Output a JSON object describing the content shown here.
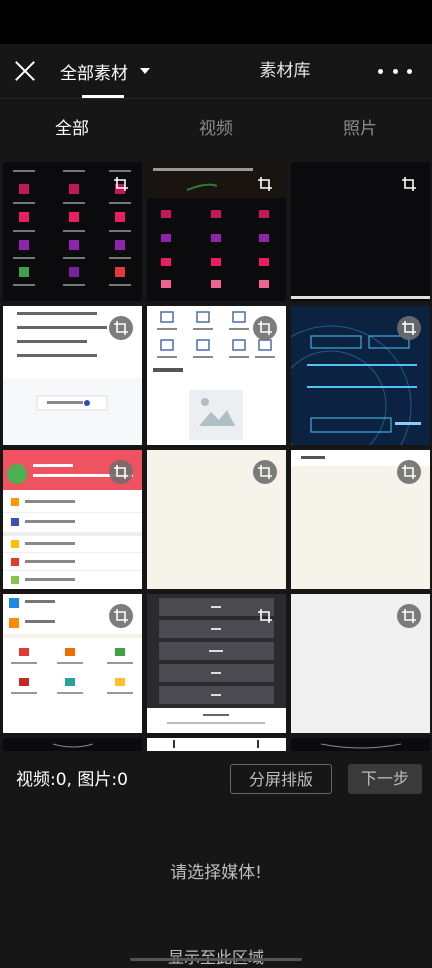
{
  "topbar": {
    "all_material": "全部素材",
    "library": "素材库"
  },
  "filters": [
    "全部",
    "视频",
    "照片"
  ],
  "thumbnails": [
    {
      "theme": "dark-icon-grid"
    },
    {
      "theme": "dark-icon-grid-banner"
    },
    {
      "theme": "black"
    },
    {
      "theme": "light-text-list"
    },
    {
      "theme": "light-icon-grid"
    },
    {
      "theme": "dark-blue-login"
    },
    {
      "theme": "red-header-list"
    },
    {
      "theme": "cream-blank"
    },
    {
      "theme": "cream-blank-titled"
    },
    {
      "theme": "light-app-menu"
    },
    {
      "theme": "dark-menu-list"
    },
    {
      "theme": "grey-blank"
    }
  ],
  "bottom": {
    "counts": "视频:0, 图片:0",
    "split_screen": "分屏排版",
    "next": "下一步",
    "prompt": "请选择媒体!",
    "drop_area": "显示至此区域"
  },
  "colors": {
    "background": "#161616",
    "status_bar": "#000000",
    "crop_badge": "#6e6e6e"
  },
  "icons": [
    "close-icon",
    "caret-down-icon",
    "more-icon",
    "crop-icon"
  ]
}
